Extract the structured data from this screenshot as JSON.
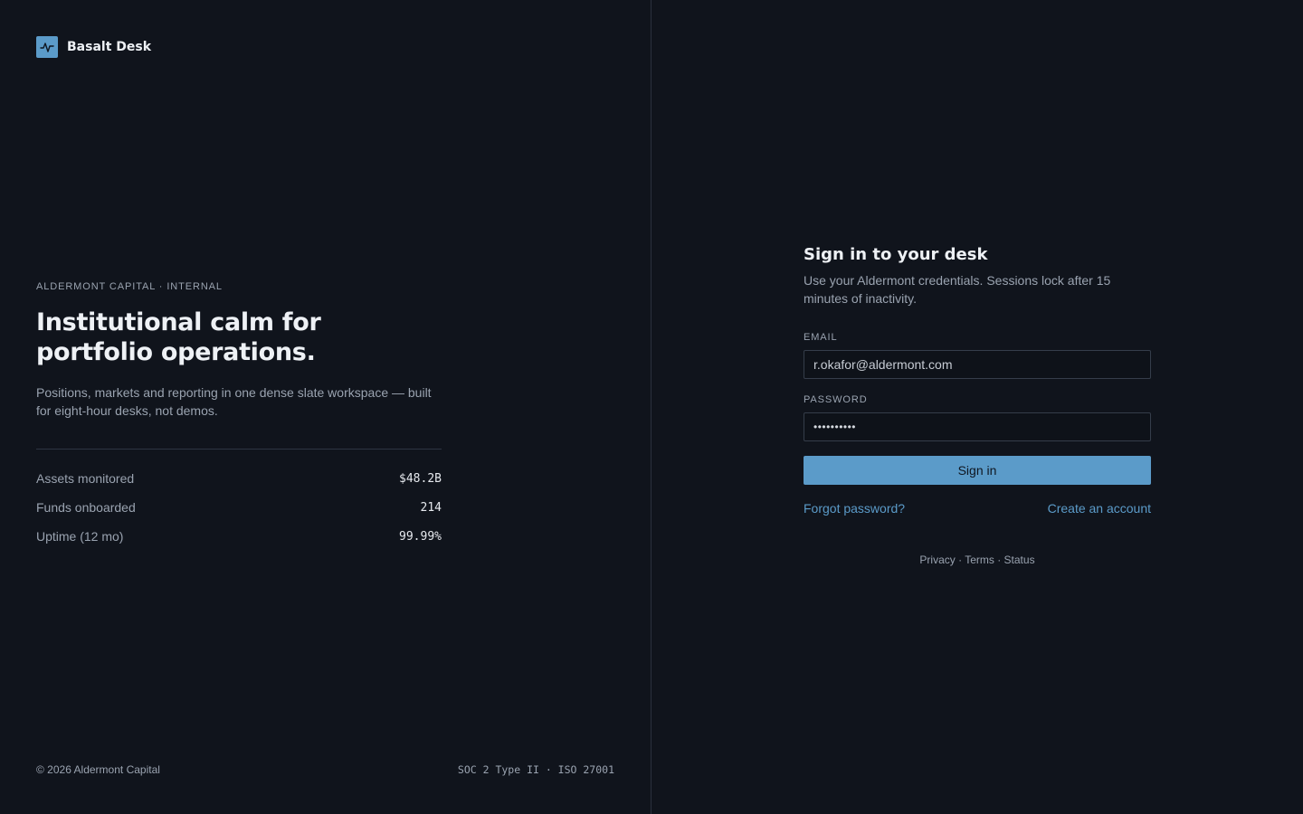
{
  "brand": {
    "name": "Basalt Desk",
    "icon": "pulse-icon",
    "accent_color": "#5b9bc9"
  },
  "hero": {
    "eyebrow": "ALDERMONT CAPITAL · INTERNAL",
    "headline": "Institutional calm for portfolio operations.",
    "subcopy": "Positions, markets and reporting in one dense slate workspace — built for eight-hour desks, not demos.",
    "stats": [
      {
        "label": "Assets monitored",
        "value": "$48.2B"
      },
      {
        "label": "Funds onboarded",
        "value": "214"
      },
      {
        "label": "Uptime (12 mo)",
        "value": "99.99%"
      }
    ]
  },
  "footer": {
    "copyright": "© 2026 Aldermont Capital",
    "certifications": "SOC 2 Type II · ISO 27001"
  },
  "signin": {
    "title": "Sign in to your desk",
    "subtitle": "Use your Aldermont credentials. Sessions lock after 15 minutes of inactivity.",
    "email_label": "EMAIL",
    "email_value": "r.okafor@aldermont.com",
    "password_label": "PASSWORD",
    "password_mask": "••••••••••",
    "submit_label": "Sign in",
    "forgot_label": "Forgot password?",
    "create_label": "Create an account"
  },
  "legal": {
    "privacy": "Privacy",
    "terms": "Terms",
    "status": "Status",
    "separator": " · "
  },
  "colors": {
    "background": "#10141c",
    "accent": "#5b9bc9",
    "muted_text": "#9aa3b0"
  }
}
